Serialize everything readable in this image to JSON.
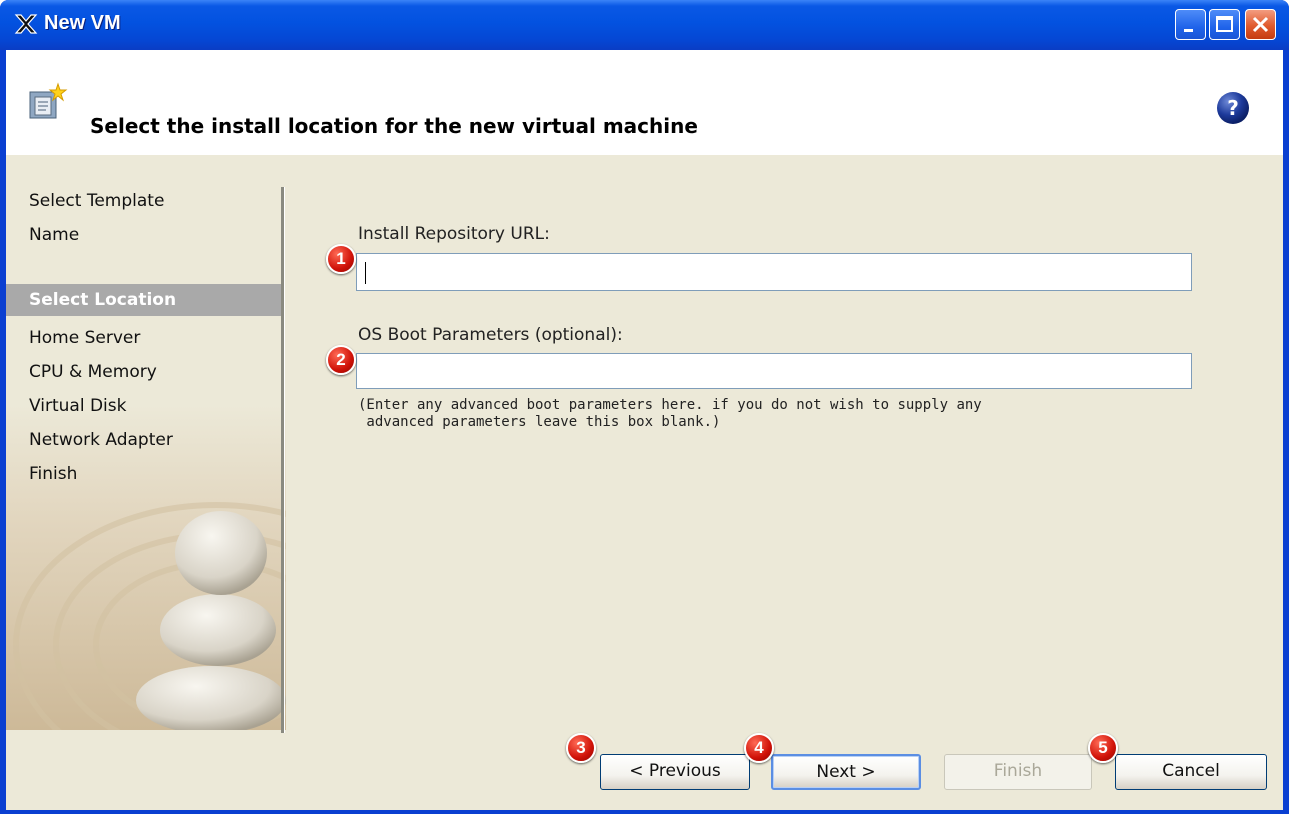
{
  "window": {
    "title": "New VM",
    "colors": {
      "titlebar": "#0352e0",
      "client": "#ece9d8",
      "header": "#ffffff",
      "marker": "#d01208"
    }
  },
  "header": {
    "title": "Select the install location for the new virtual machine",
    "icon": "wizard-page-icon",
    "help_icon": "help-icon"
  },
  "sidebar": {
    "items": [
      {
        "label": "Select Template",
        "active": false
      },
      {
        "label": "Name",
        "active": false
      },
      {
        "label": "Select Location",
        "active": true
      },
      {
        "label": "Home Server",
        "active": false
      },
      {
        "label": "CPU & Memory",
        "active": false
      },
      {
        "label": "Virtual Disk",
        "active": false
      },
      {
        "label": "Network Adapter",
        "active": false
      },
      {
        "label": "Finish",
        "active": false
      }
    ]
  },
  "form": {
    "repo_label": "Install Repository URL:",
    "repo_value": "",
    "boot_label": "OS Boot Parameters (optional):",
    "boot_value": "",
    "hint_line1": "(Enter any advanced boot parameters here. if you do not wish to supply any",
    "hint_line2": " advanced parameters leave this box blank.)"
  },
  "buttons": {
    "previous": "< Previous",
    "next": "Next >",
    "finish": "Finish",
    "cancel": "Cancel"
  },
  "markers": [
    "1",
    "2",
    "3",
    "4",
    "5"
  ]
}
